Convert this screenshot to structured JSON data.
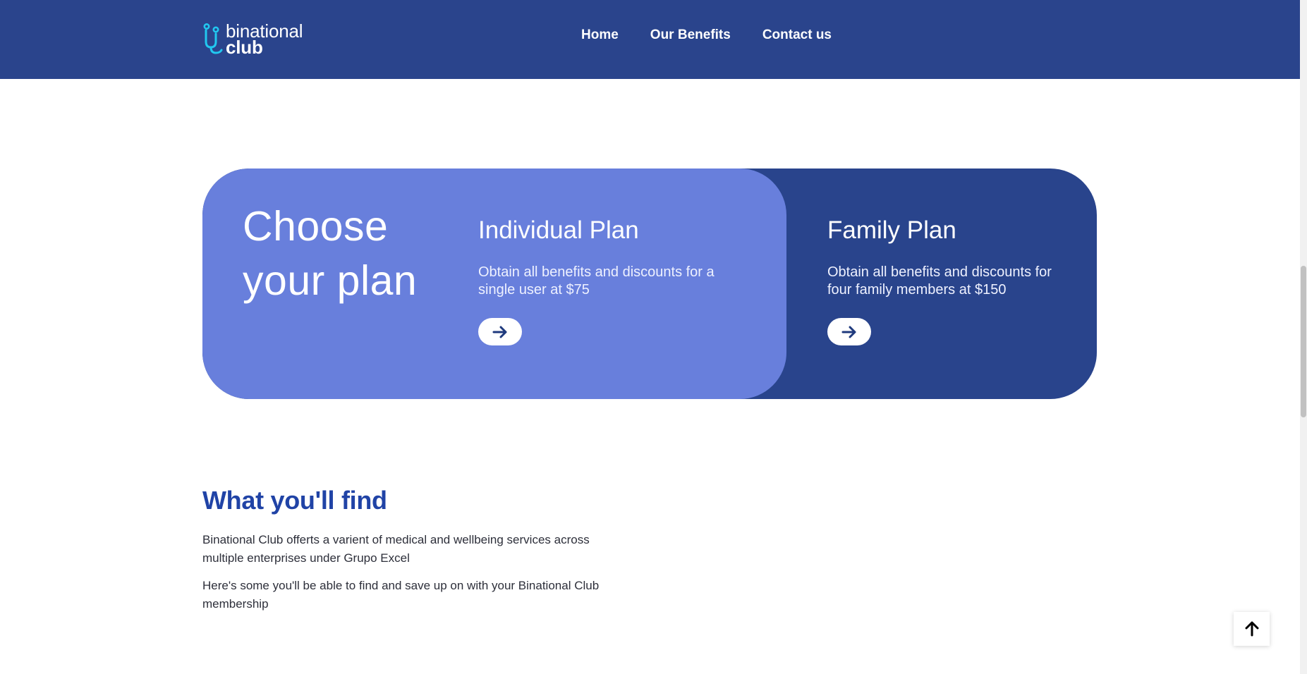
{
  "brand": {
    "name_line1": "binational",
    "name_line2": "club",
    "accent_color": "#21c8f0",
    "header_color": "#2a448c"
  },
  "nav": {
    "items": [
      {
        "label": "Home"
      },
      {
        "label": "Our Benefits"
      },
      {
        "label": "Contact us"
      }
    ]
  },
  "plans": {
    "heading": "Choose your plan",
    "individual": {
      "title": "Individual Plan",
      "description": "Obtain all benefits and discounts for a single user at $75",
      "button_icon": "arrow-right-icon",
      "background": "#687fdc"
    },
    "family": {
      "title": "Family Plan",
      "description": "Obtain all benefits and discounts for four family members at $150",
      "button_icon": "arrow-right-icon",
      "background": "#29448c"
    }
  },
  "find": {
    "title": "What you'll find",
    "paragraph1": "Binational Club offerts a varient of medical and wellbeing services across multiple enterprises under Grupo Excel",
    "paragraph2": "Here's some you'll be able to find and save up on with your Binational Club membership"
  },
  "back_to_top": {
    "icon": "arrow-up-icon"
  }
}
